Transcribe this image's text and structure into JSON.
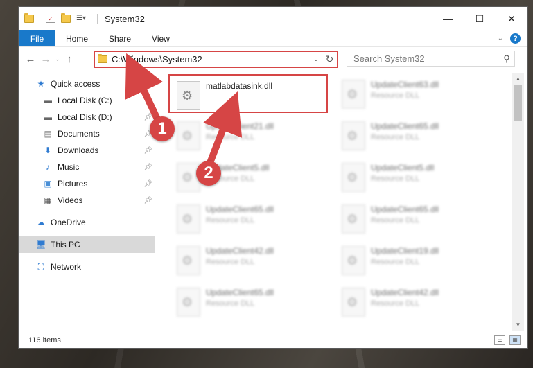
{
  "window": {
    "title": "System32",
    "controls": {
      "minimize": "—",
      "maximize": "☐",
      "close": "✕"
    }
  },
  "ribbon": {
    "file_tab": "File",
    "tabs": [
      "Home",
      "Share",
      "View"
    ]
  },
  "address": {
    "path": "C:\\Windows\\System32",
    "search_placeholder": "Search System32"
  },
  "navigation": {
    "items": [
      {
        "label": "Quick access",
        "icon": "star-icon",
        "pinned": false
      },
      {
        "label": "Local Disk (C:)",
        "icon": "drive-icon",
        "pinned": false
      },
      {
        "label": "Local Disk (D:)",
        "icon": "drive-icon",
        "pinned": true
      },
      {
        "label": "Documents",
        "icon": "documents-icon",
        "pinned": true
      },
      {
        "label": "Downloads",
        "icon": "downloads-icon",
        "pinned": true
      },
      {
        "label": "Music",
        "icon": "music-icon",
        "pinned": true
      },
      {
        "label": "Pictures",
        "icon": "pictures-icon",
        "pinned": true
      },
      {
        "label": "Videos",
        "icon": "videos-icon",
        "pinned": true
      },
      {
        "label": "OneDrive",
        "icon": "cloud-icon",
        "pinned": false
      },
      {
        "label": "This PC",
        "icon": "computer-icon",
        "pinned": false,
        "selected": true
      },
      {
        "label": "Network",
        "icon": "network-icon",
        "pinned": false
      }
    ]
  },
  "files": {
    "highlighted": {
      "name": "matlabdatasink.dll"
    },
    "left_column": [
      {
        "name": "UpdateClient21.dll",
        "type": "Resource DLL"
      },
      {
        "name": "UpdateClient5.dll",
        "type": "Resource DLL"
      },
      {
        "name": "UpdateClient65.dll",
        "type": "Resource DLL"
      },
      {
        "name": "UpdateClient42.dll",
        "type": "Resource DLL"
      },
      {
        "name": "UpdateClient65.dll",
        "type": "Resource DLL"
      }
    ],
    "right_column": [
      {
        "name": "UpdateClient63.dll",
        "type": "Resource DLL"
      },
      {
        "name": "UpdateClient65.dll",
        "type": "Resource DLL"
      },
      {
        "name": "UpdateClient5.dll",
        "type": "Resource DLL"
      },
      {
        "name": "UpdateClient65.dll",
        "type": "Resource DLL"
      },
      {
        "name": "UpdateClient19.dll",
        "type": "Resource DLL"
      },
      {
        "name": "UpdateClient42.dll",
        "type": "Resource DLL"
      }
    ]
  },
  "status": {
    "item_count": "116 items"
  },
  "annotations": {
    "step1": "1",
    "step2": "2",
    "color": "#d64545"
  }
}
